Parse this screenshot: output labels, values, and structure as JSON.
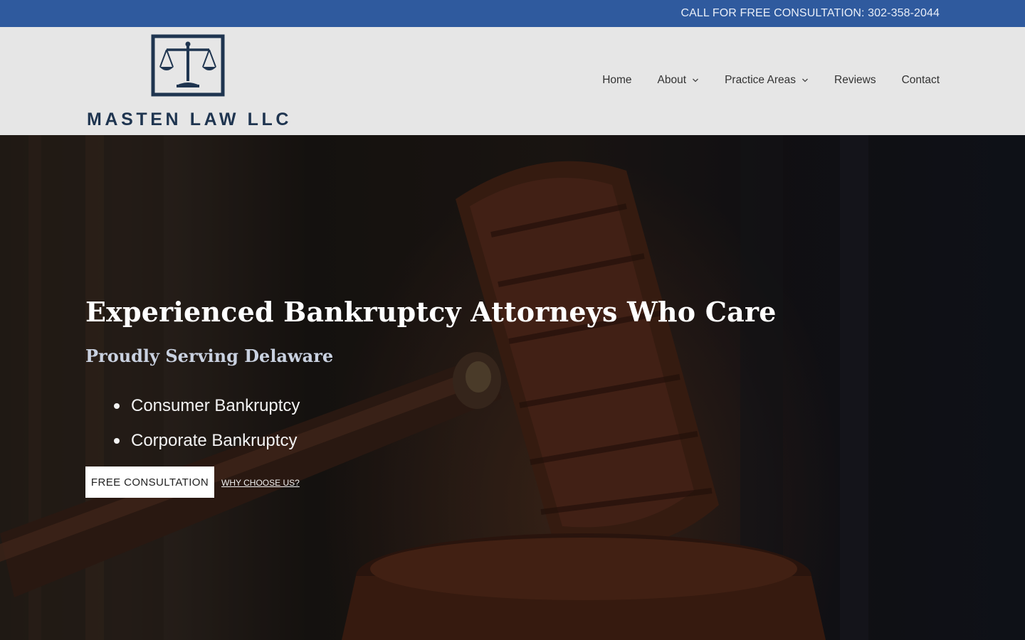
{
  "topbar": {
    "phone_text": "CALL FOR FREE CONSULTATION: 302-358-2044"
  },
  "brand": {
    "name": "MASTEN LAW LLC",
    "logo_icon": "scales-of-justice-icon",
    "color": "#1f3550"
  },
  "nav": {
    "items": [
      {
        "label": "Home",
        "has_dropdown": false
      },
      {
        "label": "About",
        "has_dropdown": true
      },
      {
        "label": "Practice Areas",
        "has_dropdown": true
      },
      {
        "label": "Reviews",
        "has_dropdown": false
      },
      {
        "label": "Contact",
        "has_dropdown": false
      }
    ]
  },
  "hero": {
    "title": "Experienced Bankruptcy Attorneys Who Care",
    "subtitle": "Proudly Serving Delaware",
    "services": [
      "Consumer Bankruptcy",
      "Corporate Bankruptcy"
    ],
    "cta_label": "FREE CONSULTATION",
    "secondary_link": "WHY CHOOSE US?",
    "background": "wooden-gavel-photo"
  },
  "colors": {
    "topbar": "#2f5a9e",
    "header": "#e6e6e6",
    "subtitle": "#c9d1e0"
  }
}
